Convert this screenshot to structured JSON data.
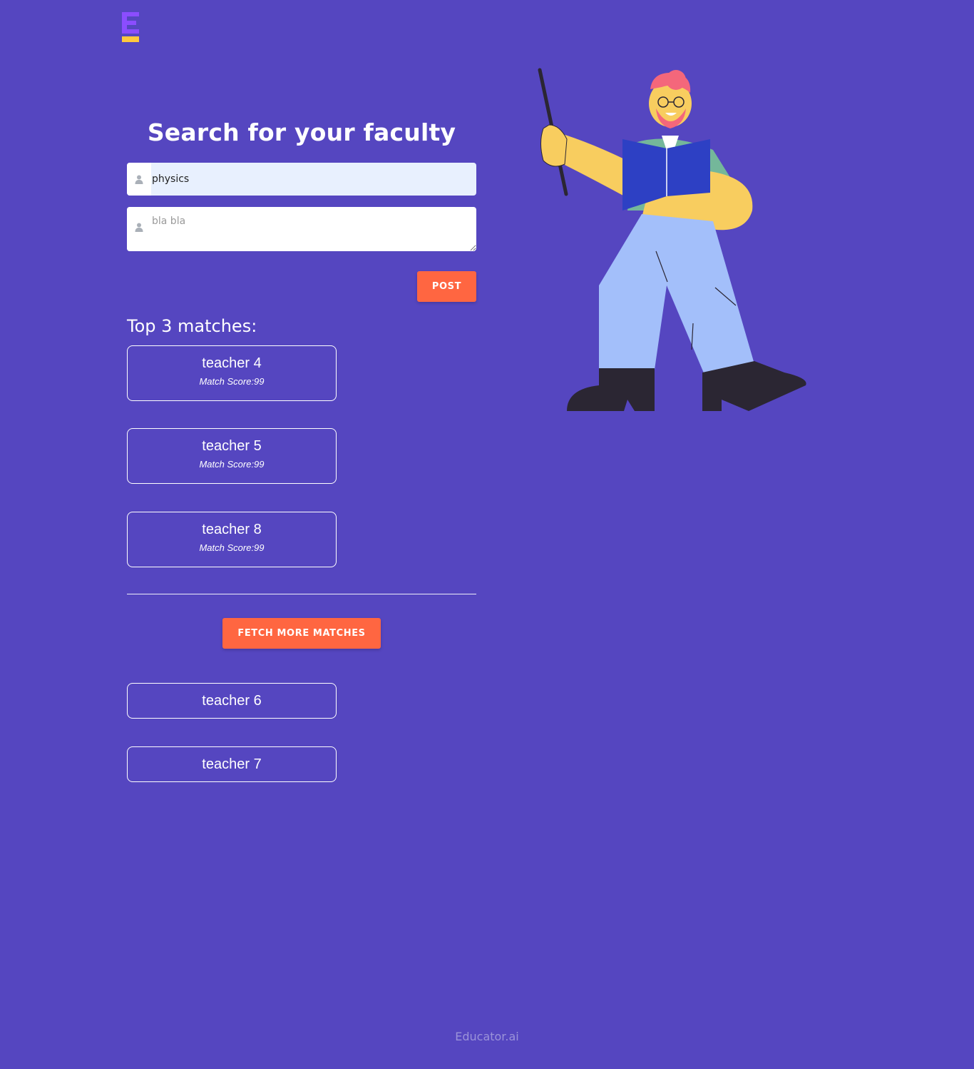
{
  "brand": {
    "logo_icon": "educator-logo-icon",
    "footer_text": "Educator.ai"
  },
  "search": {
    "title": "Search for your faculty",
    "subject_value": "physics",
    "subject_icon": "user-icon",
    "description_placeholder": "bla bla",
    "description_icon": "user-icon",
    "post_label": "POST"
  },
  "matches": {
    "heading": "Top 3 matches:",
    "items": [
      {
        "name": "teacher 4",
        "score_text": "Match Score:99"
      },
      {
        "name": "teacher 5",
        "score_text": "Match Score:99"
      },
      {
        "name": "teacher 8",
        "score_text": "Match Score:99"
      }
    ]
  },
  "more": {
    "fetch_label": "FETCH MORE MATCHES",
    "items": [
      {
        "name": "teacher 6"
      },
      {
        "name": "teacher 7"
      }
    ]
  },
  "colors": {
    "background": "#5546c0",
    "accent_button": "#ff6641",
    "logo_purple": "#8b4dff",
    "logo_yellow": "#ffc83d"
  },
  "illustration": {
    "icon": "teacher-with-pointer-illustration"
  }
}
